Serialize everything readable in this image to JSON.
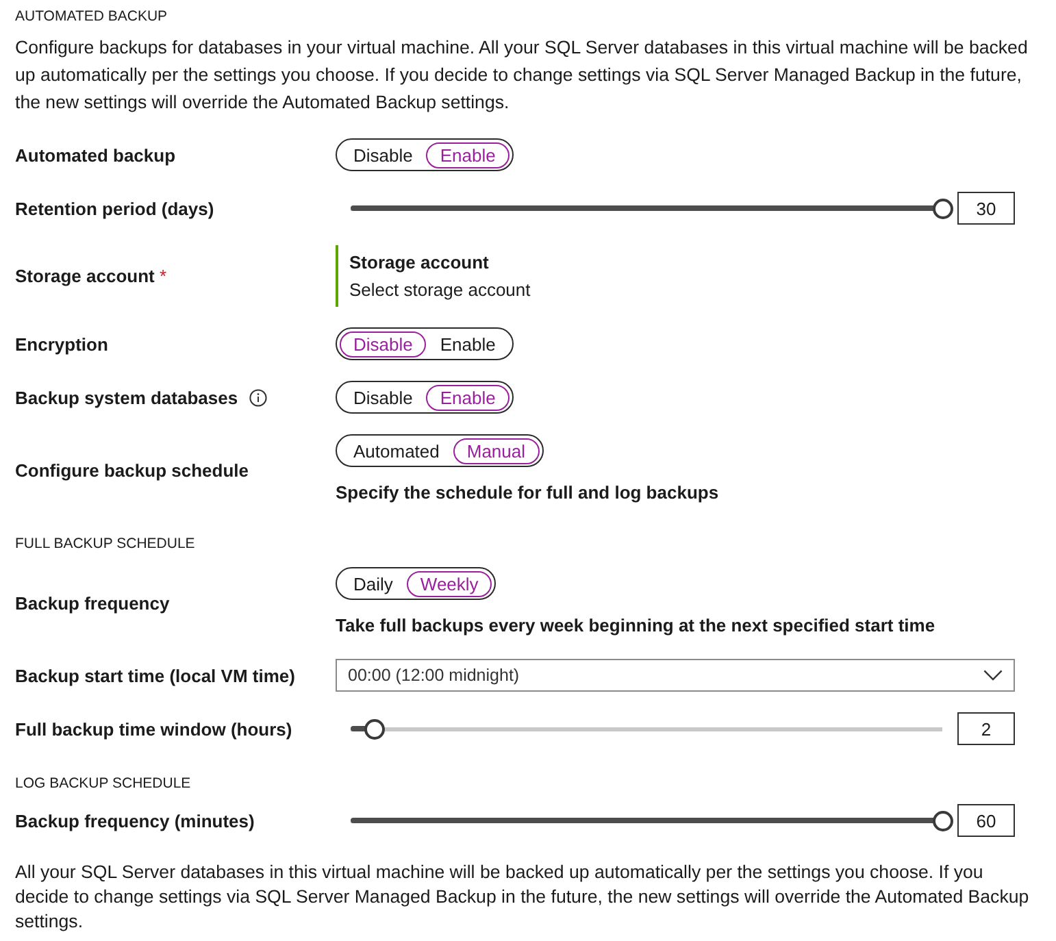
{
  "section": {
    "heading": "AUTOMATED BACKUP",
    "description": "Configure backups for databases in your virtual machine. All your SQL Server databases in this virtual machine will be backed up automatically per the settings you choose. If you decide to change settings via SQL Server Managed Backup in the future, the new settings will override the Automated Backup settings."
  },
  "settings": [
    {
      "kind": "toggle",
      "label": "Automated backup",
      "options": [
        {
          "label": "Disable",
          "selected": false
        },
        {
          "label": "Enable",
          "selected": true
        }
      ]
    },
    {
      "kind": "slider",
      "label": "Retention period (days)",
      "level": 1,
      "value": "30"
    },
    {
      "kind": "picker",
      "label": "Storage account",
      "required_mark": "*",
      "title": "Storage account",
      "placeholder": "Select storage account"
    },
    {
      "kind": "toggle",
      "label": "Encryption",
      "options": [
        {
          "label": "Disable",
          "selected": true
        },
        {
          "label": "Enable",
          "selected": false
        }
      ]
    },
    {
      "kind": "toggle",
      "label": "Backup system databases",
      "info": true,
      "options": [
        {
          "label": "Disable",
          "selected": false
        },
        {
          "label": "Enable",
          "selected": true
        }
      ]
    },
    {
      "kind": "toggle",
      "label": "Configure backup schedule",
      "options": [
        {
          "label": "Automated",
          "selected": false
        },
        {
          "label": "Manual",
          "selected": true
        }
      ],
      "hint": "Specify the schedule for full and log backups"
    },
    {
      "kind": "heading",
      "text": "FULL BACKUP SCHEDULE"
    },
    {
      "kind": "toggle",
      "label": "Backup frequency",
      "options": [
        {
          "label": "Daily",
          "selected": false
        },
        {
          "label": "Weekly",
          "selected": true
        }
      ],
      "hint": "Take full backups every week beginning at the next specified start time"
    },
    {
      "kind": "dropdown",
      "label": "Backup start time (local VM time)",
      "value": "00:00 (12:00 midnight)"
    },
    {
      "kind": "slider",
      "label": "Full backup time window (hours)",
      "level": 0.04,
      "value": "2"
    },
    {
      "kind": "heading",
      "text": "LOG BACKUP SCHEDULE"
    },
    {
      "kind": "slider",
      "label": "Backup frequency (minutes)",
      "level": 1,
      "value": "60"
    }
  ],
  "footer_note": "All your SQL Server databases in this virtual machine will be backed up automatically per the settings you choose. If you decide to change settings via SQL Server Managed Backup in the future, the new settings will override the Automated Backup settings."
}
